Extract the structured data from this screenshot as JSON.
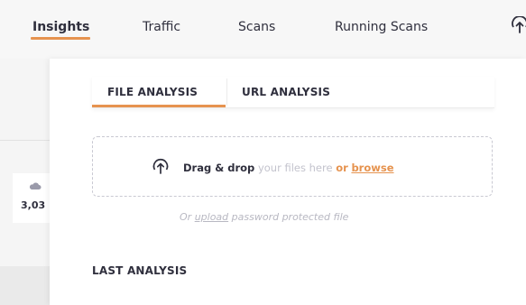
{
  "nav": {
    "items": [
      {
        "label": "Insights",
        "active": true
      },
      {
        "label": "Traffic",
        "active": false
      },
      {
        "label": "Scans",
        "active": false
      },
      {
        "label": "Running Scans",
        "active": false
      }
    ],
    "upload_icon": "upload-icon"
  },
  "left": {
    "icon": "cloud-icon",
    "value": "3,03"
  },
  "tabs": [
    {
      "label": "FILE ANALYSIS",
      "active": true
    },
    {
      "label": "URL ANALYSIS",
      "active": false
    }
  ],
  "dropzone": {
    "icon": "upload-icon",
    "strong": "Drag & drop",
    "muted": "your files here",
    "or": "or",
    "link": "browse"
  },
  "upload_note": {
    "prefix": "Or",
    "link": "upload",
    "suffix": "password protected file"
  },
  "section_title": "LAST ANALYSIS",
  "colors": {
    "accent": "#e6934f",
    "text": "#2f2f3d",
    "muted": "#c3c3cd"
  }
}
